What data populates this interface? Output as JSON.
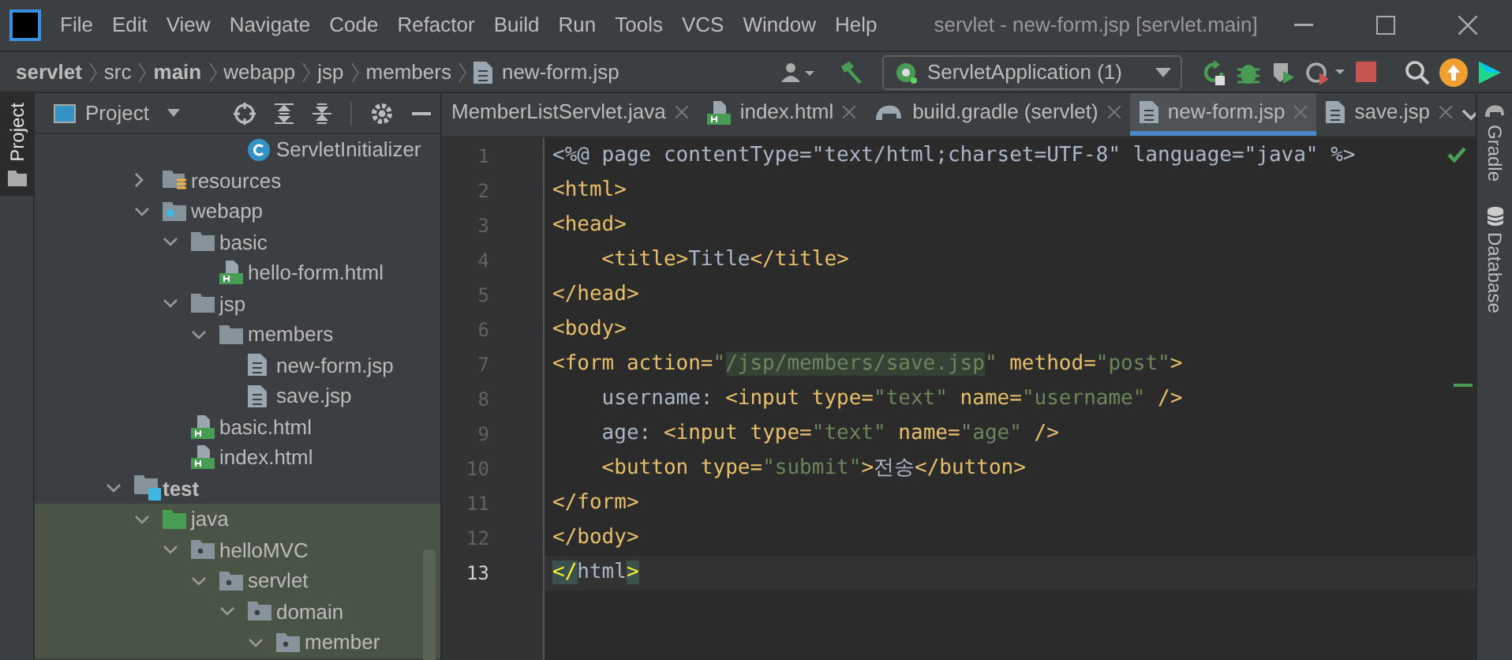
{
  "window": {
    "title": "servlet - new-form.jsp [servlet.main]"
  },
  "menu": [
    "File",
    "Edit",
    "View",
    "Navigate",
    "Code",
    "Refactor",
    "Build",
    "Run",
    "Tools",
    "VCS",
    "Window",
    "Help"
  ],
  "breadcrumbs": [
    {
      "label": "servlet",
      "bold": true
    },
    {
      "label": "src",
      "bold": false
    },
    {
      "label": "main",
      "bold": true
    },
    {
      "label": "webapp",
      "bold": false
    },
    {
      "label": "jsp",
      "bold": false
    },
    {
      "label": "members",
      "bold": false
    },
    {
      "label": "new-form.jsp",
      "bold": false
    }
  ],
  "run_config": "ServletApplication (1)",
  "left_strip": [
    {
      "label": "Project",
      "selected": true
    }
  ],
  "right_strip": [
    {
      "label": "Gradle"
    },
    {
      "label": "Database"
    }
  ],
  "project_panel": {
    "title": "Project"
  },
  "tree": [
    {
      "children": [
        {
          "children": [
            {
              "children": [
                {
                  "children": [
                    {
                      "children": [
                        {
                          "children": [
                            {
                              "label": "ServletInitializer",
                              "kind": "class",
                              "tinted": false
                            }
                          ]
                        }
                      ]
                    }
                  ]
                },
                {
                  "label": "resources",
                  "kind": "resources",
                  "expanded": false,
                  "tinted": false
                },
                {
                  "label": "webapp",
                  "kind": "webapp",
                  "expanded": true,
                  "tinted": false,
                  "children": [
                    {
                      "label": "basic",
                      "kind": "folder",
                      "expanded": true,
                      "tinted": false,
                      "children": [
                        {
                          "label": "hello-form.html",
                          "kind": "html",
                          "tinted": false
                        }
                      ]
                    },
                    {
                      "label": "jsp",
                      "kind": "folder",
                      "expanded": true,
                      "tinted": false,
                      "children": [
                        {
                          "label": "members",
                          "kind": "folder",
                          "expanded": true,
                          "tinted": false,
                          "children": [
                            {
                              "label": "new-form.jsp",
                              "kind": "jsp",
                              "tinted": false
                            },
                            {
                              "label": "save.jsp",
                              "kind": "jsp",
                              "tinted": false
                            }
                          ]
                        }
                      ]
                    },
                    {
                      "label": "basic.html",
                      "kind": "html",
                      "tinted": false
                    },
                    {
                      "label": "index.html",
                      "kind": "html",
                      "tinted": false
                    }
                  ]
                }
              ]
            },
            {
              "label": "test",
              "kind": "test-root",
              "expanded": true,
              "tinted": false,
              "bold": true,
              "children": [
                {
                  "label": "java",
                  "kind": "source",
                  "expanded": true,
                  "tinted": true,
                  "children": [
                    {
                      "label": "helloMVC",
                      "kind": "package",
                      "expanded": true,
                      "tinted": true,
                      "children": [
                        {
                          "label": "servlet",
                          "kind": "package",
                          "expanded": true,
                          "tinted": true,
                          "children": [
                            {
                              "label": "domain",
                              "kind": "package",
                              "expanded": true,
                              "tinted": true,
                              "children": [
                                {
                                  "label": "member",
                                  "kind": "package",
                                  "expanded": true,
                                  "tinted": true
                                }
                              ]
                            }
                          ]
                        }
                      ]
                    }
                  ]
                }
              ]
            }
          ]
        }
      ]
    }
  ],
  "tabs": [
    {
      "label": "MemberListServlet.java",
      "kind": "java",
      "selected": false
    },
    {
      "label": "index.html",
      "kind": "html",
      "selected": false
    },
    {
      "label": "build.gradle (servlet)",
      "kind": "gradle",
      "selected": false
    },
    {
      "label": "new-form.jsp",
      "kind": "jsp",
      "selected": true
    },
    {
      "label": "save.jsp",
      "kind": "jsp",
      "selected": false
    }
  ],
  "code": [
    {
      "number": "1",
      "current": false,
      "tokens": [
        {
          "kind": "text",
          "text": "<%@ page contentType=\"text/html;charset=UTF-8\" language=\"java\" %>"
        }
      ]
    },
    {
      "number": "2",
      "current": false,
      "tokens": [
        {
          "kind": "tag",
          "text": "<html>"
        }
      ]
    },
    {
      "number": "3",
      "current": false,
      "tokens": [
        {
          "kind": "tag",
          "text": "<head>"
        }
      ]
    },
    {
      "number": "4",
      "current": false,
      "tokens": [
        {
          "kind": "tag",
          "text": "    <title>"
        },
        {
          "kind": "text",
          "text": "Title"
        },
        {
          "kind": "tag",
          "text": "</title>"
        }
      ]
    },
    {
      "number": "5",
      "current": false,
      "tokens": [
        {
          "kind": "tag",
          "text": "</head>"
        }
      ]
    },
    {
      "number": "6",
      "current": false,
      "tokens": [
        {
          "kind": "tag",
          "text": "<body>"
        }
      ]
    },
    {
      "number": "7",
      "current": false,
      "tokens": [
        {
          "kind": "tag",
          "text": "<form action="
        },
        {
          "kind": "string",
          "text": "\""
        },
        {
          "kind": "marked-string",
          "text": "/jsp/members/save.jsp"
        },
        {
          "kind": "string",
          "text": "\""
        },
        {
          "kind": "tag",
          "text": " method="
        },
        {
          "kind": "string",
          "text": "\"post\""
        },
        {
          "kind": "tag",
          "text": ">"
        }
      ]
    },
    {
      "number": "8",
      "current": false,
      "tokens": [
        {
          "kind": "text",
          "text": "    username: "
        },
        {
          "kind": "tag",
          "text": "<input type="
        },
        {
          "kind": "string",
          "text": "\"text\""
        },
        {
          "kind": "tag",
          "text": " name="
        },
        {
          "kind": "string",
          "text": "\"username\""
        },
        {
          "kind": "tag",
          "text": " />"
        }
      ]
    },
    {
      "number": "9",
      "current": false,
      "tokens": [
        {
          "kind": "text",
          "text": "    age: "
        },
        {
          "kind": "tag",
          "text": "<input type="
        },
        {
          "kind": "string",
          "text": "\"text\""
        },
        {
          "kind": "tag",
          "text": " name="
        },
        {
          "kind": "string",
          "text": "\"age\""
        },
        {
          "kind": "tag",
          "text": " />"
        }
      ]
    },
    {
      "number": "10",
      "current": false,
      "tokens": [
        {
          "kind": "tag",
          "text": "    <button type="
        },
        {
          "kind": "string",
          "text": "\"submit\""
        },
        {
          "kind": "tag",
          "text": ">"
        },
        {
          "kind": "text",
          "text": "전송"
        },
        {
          "kind": "tag",
          "text": "</button>"
        }
      ]
    },
    {
      "number": "11",
      "current": false,
      "tokens": [
        {
          "kind": "tag",
          "text": "</form>"
        }
      ]
    },
    {
      "number": "12",
      "current": false,
      "tokens": [
        {
          "kind": "tag",
          "text": "</body>"
        }
      ]
    },
    {
      "number": "13",
      "current": true,
      "tokens": [
        {
          "kind": "match",
          "text": "</"
        },
        {
          "kind": "text",
          "text": "html"
        },
        {
          "kind": "match",
          "text": ">"
        }
      ]
    }
  ]
}
